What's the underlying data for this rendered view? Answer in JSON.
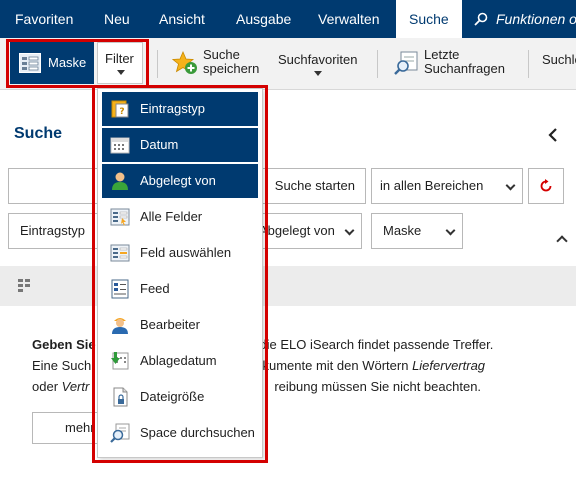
{
  "menu": {
    "tabs": [
      "Favoriten",
      "Neu",
      "Ansicht",
      "Ausgabe",
      "Verwalten",
      "Suche"
    ],
    "active": "Suche",
    "search_hint": "Funktionen o"
  },
  "ribbon": {
    "maske": "Maske",
    "filter": "Filter",
    "save_line1": "Suche",
    "save_line2": "speichern",
    "favorites": "Suchfavoriten",
    "last_line1": "Letzte",
    "last_line2": "Suchanfragen",
    "more": "Suchle"
  },
  "panel": {
    "title": "Suche",
    "start_button": "Suche starten",
    "area_select": "in allen Bereichen",
    "chip_type": "Eintragstyp",
    "chip_filed_by": "Abgelegt von",
    "chip_mask": "Maske",
    "hint_line1_bold": "Geben Sie",
    "hint_line1_rest": "d die ELO iSearch findet passende Treffer.",
    "hint_line2a": "Eine Such",
    "hint_line2b": "okumente mit den Wörtern ",
    "hint_line2c": "Liefervertrag",
    "hint_line3a": "oder ",
    "hint_line3b": "Vertr",
    "hint_line3c": "reibung müssen Sie nicht beachten.",
    "more_button": "mehr"
  },
  "filter_menu": {
    "items": [
      {
        "label": "Eintragstyp",
        "icon": "entry-type-icon",
        "selected": true
      },
      {
        "label": "Datum",
        "icon": "calendar-icon",
        "selected": true
      },
      {
        "label": "Abgelegt von",
        "icon": "user-icon",
        "selected": true
      },
      {
        "label": "Alle Felder",
        "icon": "all-fields-icon",
        "selected": false
      },
      {
        "label": "Feld auswählen",
        "icon": "select-field-icon",
        "selected": false
      },
      {
        "label": "Feed",
        "icon": "feed-icon",
        "selected": false
      },
      {
        "label": "Bearbeiter",
        "icon": "editor-icon",
        "selected": false
      },
      {
        "label": "Ablagedatum",
        "icon": "filing-date-icon",
        "selected": false
      },
      {
        "label": "Dateigröße",
        "icon": "file-size-icon",
        "selected": false
      },
      {
        "label": "Space durchsuchen",
        "icon": "search-space-icon",
        "selected": false
      }
    ]
  },
  "colors": {
    "brand": "#003a70",
    "highlight": "#d40000",
    "accent": "#f5a623"
  }
}
